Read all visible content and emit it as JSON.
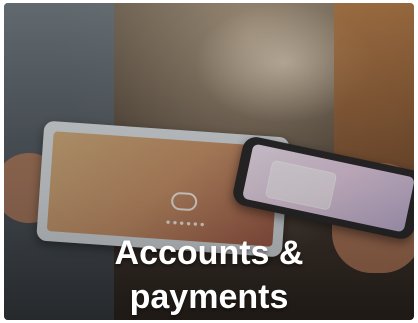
{
  "tile": {
    "title_line1": "Accounts &",
    "title_line2": "payments"
  },
  "colors": {
    "title_text": "#ffffff",
    "overlay": "#000000"
  },
  "icons": {
    "tablet_logo": "payment-logo-icon",
    "tablet_dots": "pin-dots-icon"
  }
}
